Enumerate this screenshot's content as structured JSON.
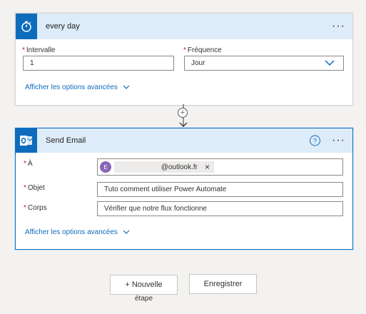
{
  "trigger": {
    "title": "every day",
    "more": "···",
    "interval_label": "Intervalle",
    "interval_value": "1",
    "frequency_label": "Fréquence",
    "frequency_value": "Jour",
    "advanced_link": "Afficher les options avancées"
  },
  "action": {
    "title": "Send Email",
    "help": "?",
    "more": "···",
    "to_label": "À",
    "to_avatar_initial": "E",
    "to_recipient": "@outlook.fr",
    "to_remove": "×",
    "subject_label": "Objet",
    "subject_value": "Tuto comment utiliser Power Automate",
    "body_label": "Corps",
    "body_value": "Vérifier que notre flux fonctionne",
    "advanced_link": "Afficher les options avancées"
  },
  "required_marker": "*",
  "footer": {
    "new_step_label": "+ Nouvelle",
    "new_step_label_2": "étape",
    "save_label": "Enregistrer"
  },
  "colors": {
    "accent": "#0f6cbd",
    "header_bg": "#deecf9",
    "required": "#a4262c",
    "avatar": "#8764b8"
  },
  "icons": {
    "trigger": "stopwatch-icon",
    "action": "outlook-icon",
    "dropdown": "chevron-down-icon",
    "add": "plus-icon"
  }
}
